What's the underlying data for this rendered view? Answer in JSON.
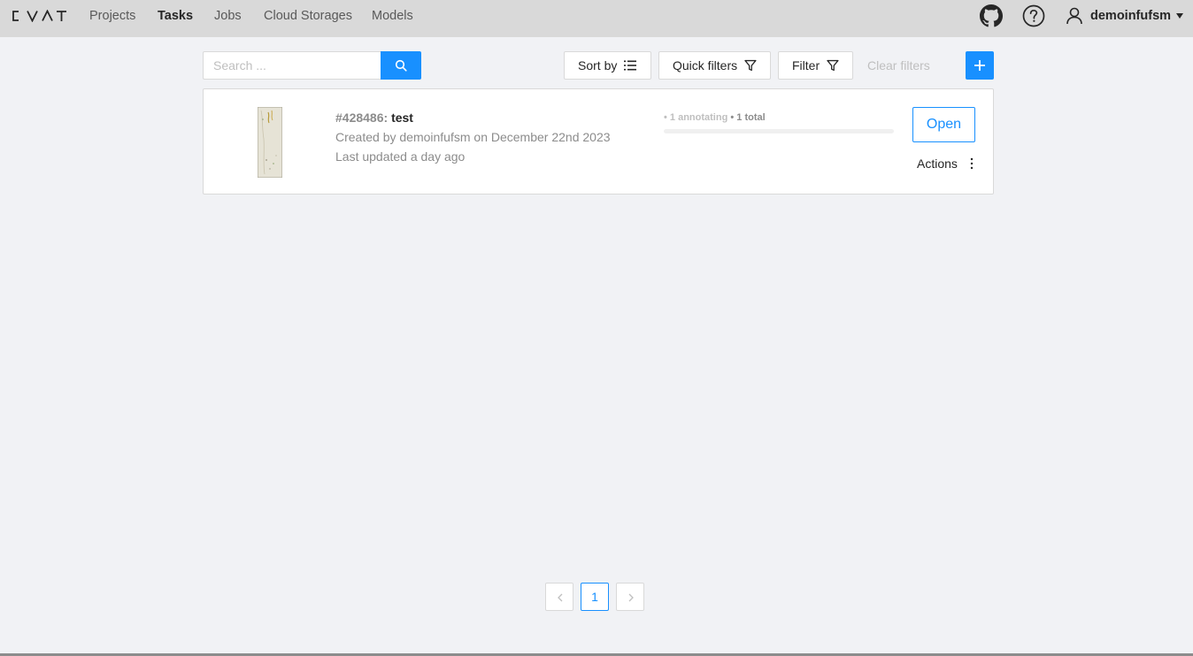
{
  "header": {
    "logo": "CVAT",
    "nav": [
      {
        "label": "Projects",
        "active": false
      },
      {
        "label": "Tasks",
        "active": true
      },
      {
        "label": "Jobs",
        "active": false
      },
      {
        "label": "Cloud Storages",
        "active": false
      },
      {
        "label": "Models",
        "active": false
      }
    ],
    "icons": [
      "github-icon",
      "help-icon",
      "user-icon",
      "caret-down-icon"
    ],
    "username": "demoinfufsm"
  },
  "toolbar": {
    "search": {
      "placeholder": "Search ...",
      "value": ""
    },
    "search_icon": "search-icon",
    "sort_label": "Sort by",
    "quick_filters_label": "Quick filters",
    "filter_label": "Filter",
    "clear_filters_label": "Clear filters",
    "add_icon": "plus-icon"
  },
  "tasks": [
    {
      "id": "#428486:",
      "name": "test",
      "created": "Created by demoinfufsm on December 22nd 2023",
      "updated": "Last updated a day ago",
      "progress_annotating": "• 1 annotating",
      "progress_total": "• 1 total",
      "progress_completed_fraction": 0,
      "open_label": "Open",
      "actions_label": "Actions"
    }
  ],
  "pagination": {
    "current_page": "1",
    "prev_icon": "chevron-left-icon",
    "next_icon": "chevron-right-icon"
  },
  "colors": {
    "accent": "#1890ff",
    "header_bg": "#d9d9d9",
    "page_bg": "#f1f2f5"
  }
}
